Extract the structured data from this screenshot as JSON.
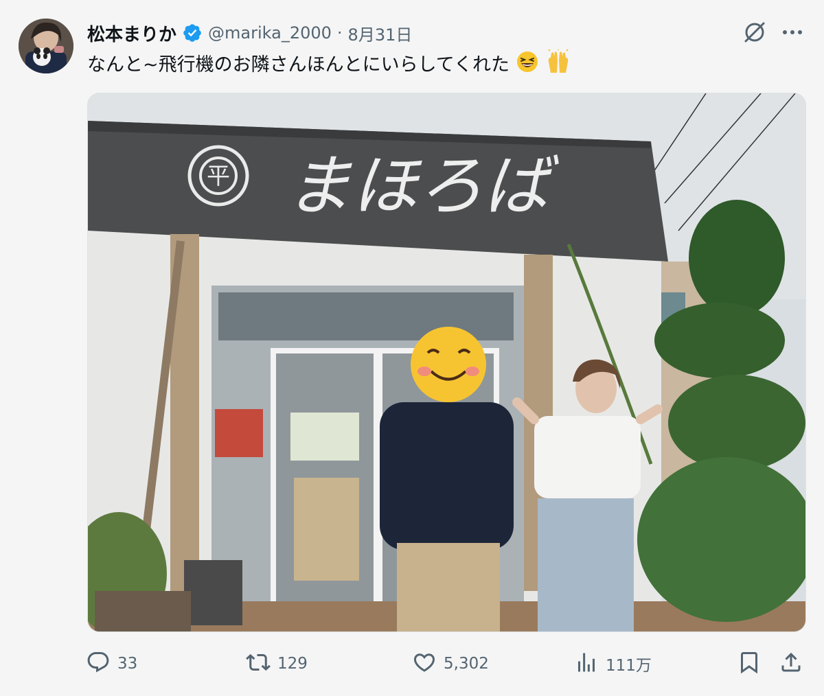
{
  "tweet": {
    "display_name": "松本まりか",
    "handle": "@marika_2000",
    "separator": "·",
    "date": "8月31日",
    "text": "なんと~飛行機のお隣さんほんとにいらしてくれた"
  },
  "photo": {
    "sign_text": "まほろば",
    "sign_logo_text": "平"
  },
  "actions": {
    "reply_count": "33",
    "repost_count": "129",
    "like_count": "5,302",
    "views_count": "111万"
  },
  "icons": {
    "verified": "verified-badge-icon",
    "grok": "grok-icon",
    "more": "more-icon",
    "reply": "reply-icon",
    "repost": "repost-icon",
    "like": "heart-icon",
    "views": "views-icon",
    "bookmark": "bookmark-icon",
    "share": "share-icon"
  },
  "colors": {
    "verified": "#1d9bf0",
    "secondary_text": "#536471",
    "primary_text": "#0f1419"
  }
}
